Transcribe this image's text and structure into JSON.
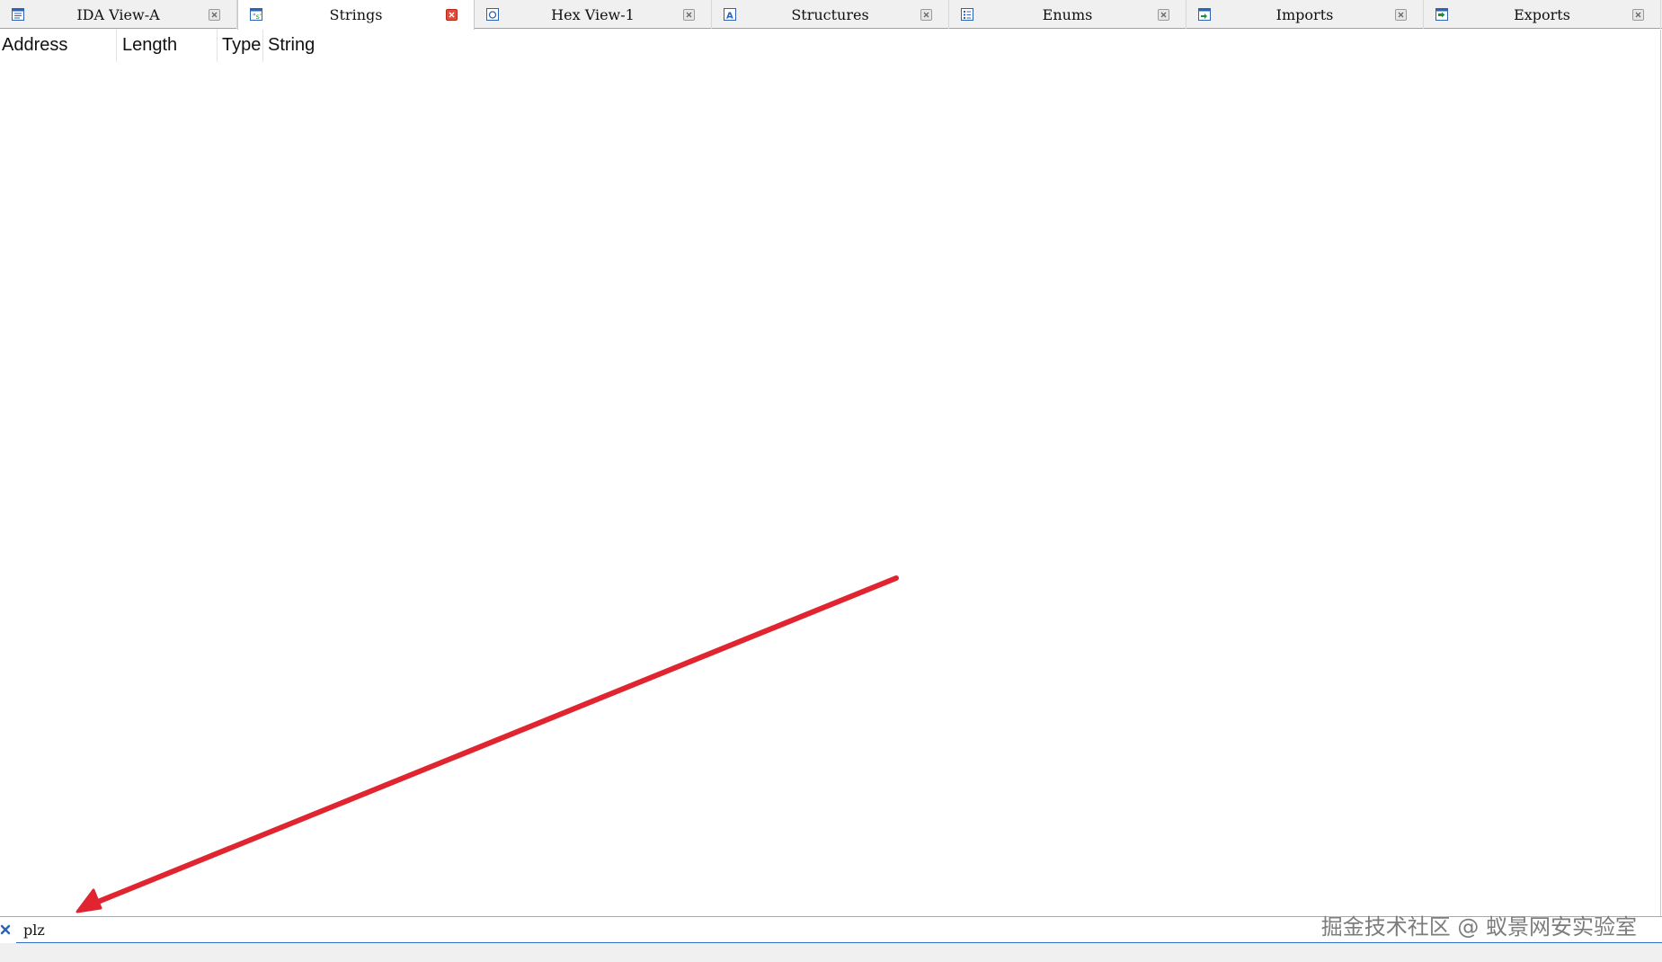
{
  "tabs": [
    {
      "label": "IDA View-A",
      "icon": "disassembly-view-icon",
      "active": false
    },
    {
      "label": "Strings",
      "icon": "strings-view-icon",
      "active": true
    },
    {
      "label": "Hex View-1",
      "icon": "hex-view-icon",
      "active": false
    },
    {
      "label": "Structures",
      "icon": "structures-icon",
      "active": false
    },
    {
      "label": "Enums",
      "icon": "enums-icon",
      "active": false
    },
    {
      "label": "Imports",
      "icon": "imports-icon",
      "active": false
    },
    {
      "label": "Exports",
      "icon": "exports-icon",
      "active": false
    }
  ],
  "columns": {
    "address": "Address",
    "length": "Length",
    "type": "Type",
    "string": "String"
  },
  "rows": [],
  "filter": {
    "value": "plz",
    "close_icon": "close-filter-icon"
  },
  "annotation": {
    "color": "#e02530"
  },
  "watermark": "掘金技术社区 @ 蚁景网安实验室",
  "colors": {
    "active_close": "#e34a3a",
    "filter_underline": "#2f6fc7",
    "icon_blue": "#2b63b8"
  }
}
